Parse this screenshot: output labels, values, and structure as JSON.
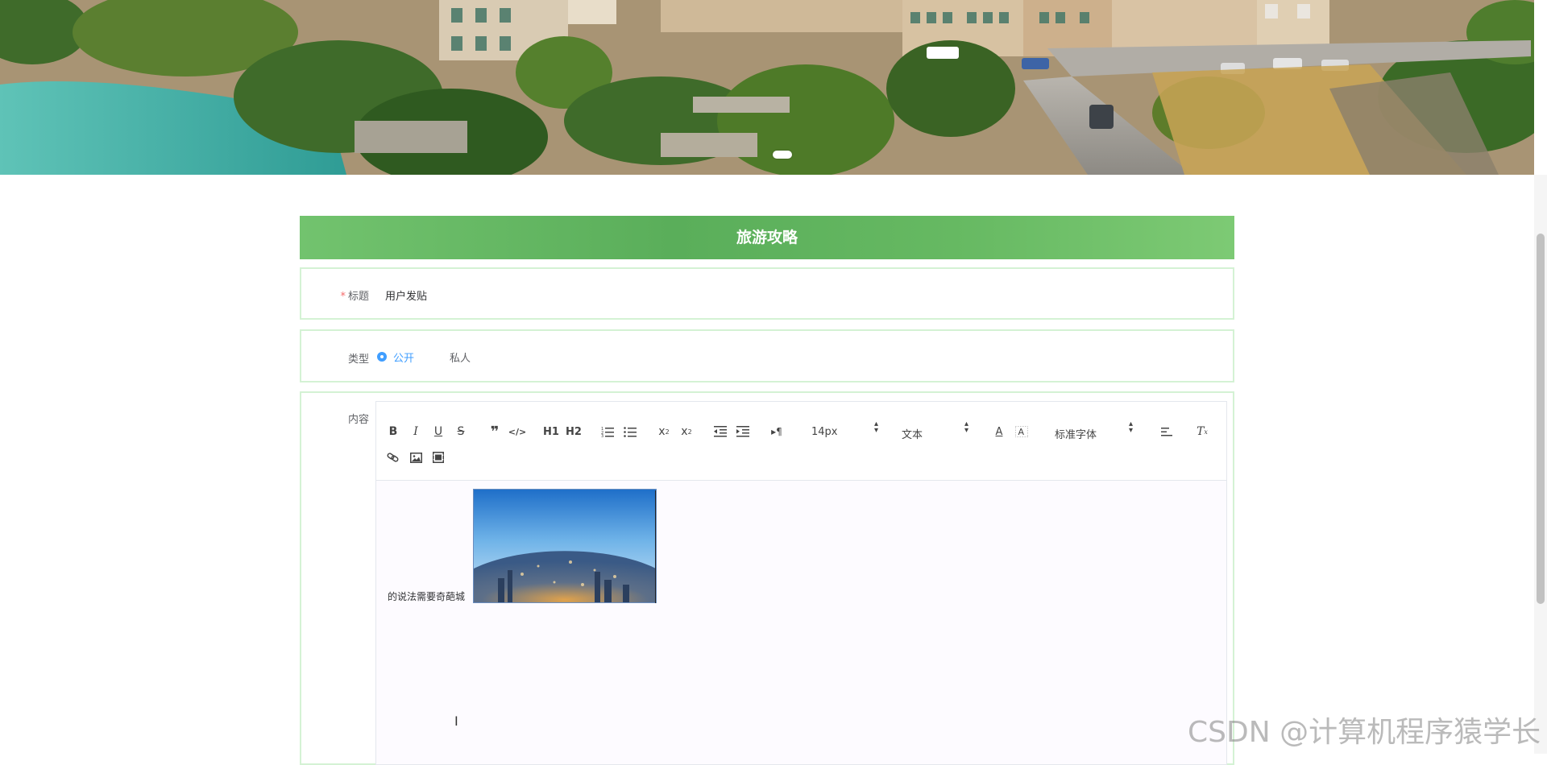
{
  "form": {
    "header_title": "旅游攻略",
    "title_label": "标题",
    "title_value": "用户发贴",
    "type_label": "类型",
    "type_options": [
      {
        "label": "公开",
        "checked": true
      },
      {
        "label": "私人",
        "checked": false
      }
    ],
    "content_label": "内容"
  },
  "editor": {
    "toolbar": {
      "bold": "bold-icon",
      "italic": "italic-icon",
      "underline": "underline-icon",
      "strike": "strike-icon",
      "blockquote": "quote-icon",
      "code": "code-icon",
      "h1_label": "H1",
      "h2_label": "H2",
      "ordered_list": "ordered-list-icon",
      "bullet_list": "bullet-list-icon",
      "subscript": "subscript-icon",
      "superscript": "superscript-icon",
      "outdent": "outdent-icon",
      "indent": "indent-icon",
      "direction": "direction-icon",
      "size_value": "14px",
      "header_value": "文本",
      "font_value": "标准字体",
      "color": "color-icon",
      "background": "background-icon",
      "align": "align-icon",
      "clean": "clean-icon",
      "link": "link-icon",
      "image": "image-icon",
      "video": "video-icon"
    },
    "body_text": "的说法需要奇葩城"
  },
  "watermark": "CSDN @计算机程序猿学长",
  "colors": {
    "header_green": "#5aae5a",
    "row_border": "#d4f2d4",
    "radio_blue": "#409eff",
    "required_red": "#f56c6c"
  }
}
